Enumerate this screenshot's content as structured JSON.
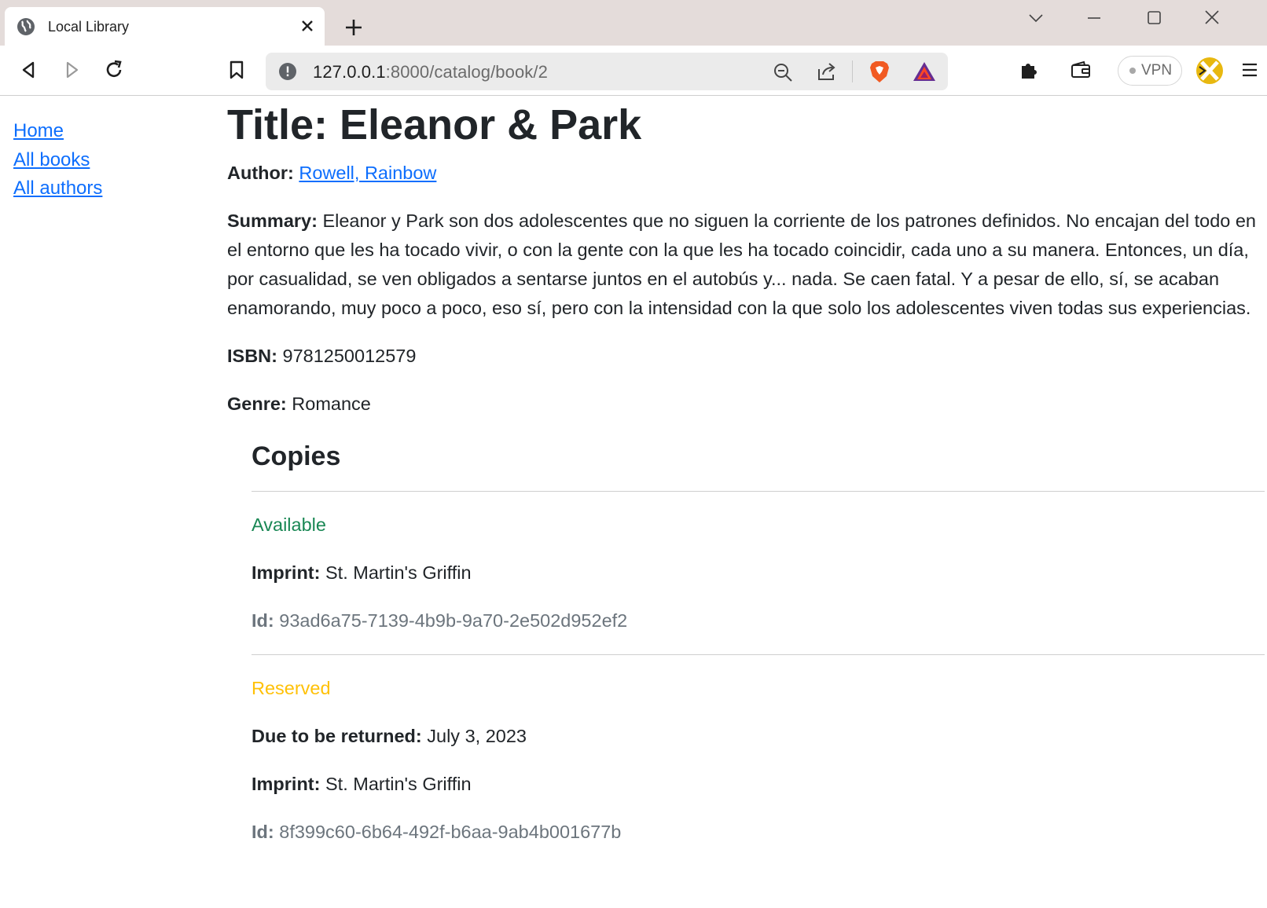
{
  "browser": {
    "tab_title": "Local Library",
    "url_host": "127.0.0.1",
    "url_rest": ":8000/catalog/book/2",
    "vpn_label": "VPN"
  },
  "nav": {
    "items": [
      {
        "label": "Home"
      },
      {
        "label": "All books"
      },
      {
        "label": "All authors"
      }
    ]
  },
  "book": {
    "title": "Title: Eleanor & Park",
    "author_label": "Author:",
    "author": "Rowell, Rainbow",
    "summary_label": "Summary:",
    "summary": "Eleanor y Park son dos adolescentes que no siguen la corriente de los patrones definidos. No encajan del todo en el entorno que les ha tocado vivir, o con la gente con la que les ha tocado coincidir, cada uno a su manera. Entonces, un día, por casualidad, se ven obligados a sentarse juntos en el autobús y... nada. Se caen fatal. Y a pesar de ello, sí, se acaban enamorando, muy poco a poco, eso sí, pero con la intensidad con la que solo los adolescentes viven todas sus experiencias.",
    "isbn_label": "ISBN:",
    "isbn": "9781250012579",
    "genre_label": "Genre:",
    "genre": "Romance"
  },
  "copies": {
    "heading": "Copies",
    "items": [
      {
        "status": "Available",
        "imprint_label": "Imprint:",
        "imprint": "St. Martin's Griffin",
        "id_label": "Id:",
        "id": "93ad6a75-7139-4b9b-9a70-2e502d952ef2"
      },
      {
        "status": "Reserved",
        "due_label": "Due to be returned:",
        "due": "July 3, 2023",
        "imprint_label": "Imprint:",
        "imprint": "St. Martin's Griffin",
        "id_label": "Id:",
        "id": "8f399c60-6b64-492f-b6aa-9ab4b001677b"
      }
    ]
  },
  "colors": {
    "link": "#0d6efd",
    "available": "#198754",
    "reserved": "#ffc107",
    "muted": "#6c757d"
  }
}
